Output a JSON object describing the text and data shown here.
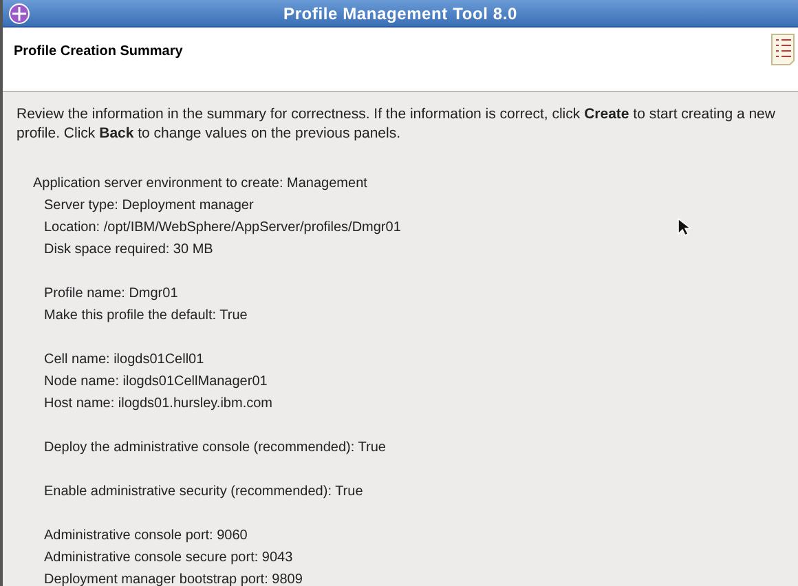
{
  "window": {
    "title": "Profile Management Tool 8.0"
  },
  "header": {
    "title": "Profile Creation Summary"
  },
  "intro": "Review the information in the summary for correctness. If the information is correct, click **Create** to start creating a new profile. Click **Back** to change values on the previous panels.",
  "summary": {
    "heading": "Application server environment to create: Management",
    "groups": [
      [
        "Server type: Deployment manager",
        "Location: /opt/IBM/WebSphere/AppServer/profiles/Dmgr01",
        "Disk space required: 30 MB"
      ],
      [
        "Profile name: Dmgr01",
        "Make this profile the default: True"
      ],
      [
        "Cell name: ilogds01Cell01",
        "Node name: ilogds01CellManager01",
        "Host name: ilogds01.hursley.ibm.com"
      ],
      [
        "Deploy the administrative console (recommended): True"
      ],
      [
        "Enable administrative security (recommended): True"
      ],
      [
        "Administrative console port: 9060",
        "Administrative console secure port: 9043",
        "Deployment manager bootstrap port: 9809"
      ]
    ]
  }
}
